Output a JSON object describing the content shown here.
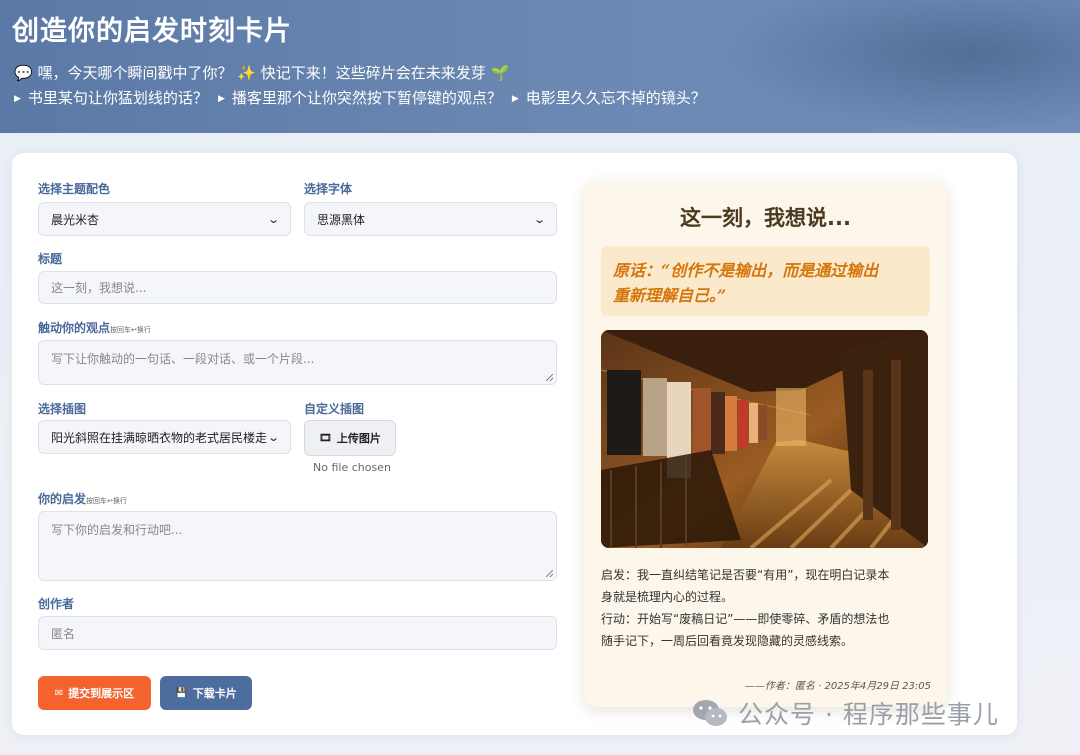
{
  "header": {
    "title": "创造你的启发时刻卡片",
    "line1": {
      "bubble_icon": "💬",
      "text_a": "嘿，今天哪个瞬间戳中了你？",
      "sparkle_icon": "✨",
      "text_b": "快记下来！这些碎片会在未来发芽",
      "sprout_icon": "🌱"
    },
    "prompts": [
      "书里某句让你猛划线的话？",
      "播客里那个让你突然按下暂停键的观点？",
      "电影里久久忘不掉的镜头？"
    ]
  },
  "form": {
    "theme": {
      "label": "选择主题配色",
      "value": "晨光米杏"
    },
    "font": {
      "label": "选择字体",
      "value": "思源黑体"
    },
    "title": {
      "label": "标题",
      "placeholder": "这一刻，我想说..."
    },
    "viewpoint": {
      "label": "触动你的观点",
      "hint": "按回车↩换行",
      "placeholder": "写下让你触动的一句话、一段对话、或一个片段..."
    },
    "illustration": {
      "label": "选择插图",
      "value": "阳光斜照在挂满晾晒衣物的老式居民楼走"
    },
    "custom_illustration": {
      "label": "自定义插图",
      "upload_label": "上传图片",
      "no_file": "No file chosen"
    },
    "insight": {
      "label": "你的启发",
      "hint": "按回车↩换行",
      "placeholder": "写下你的启发和行动吧..."
    },
    "author": {
      "label": "创作者",
      "placeholder": "匿名"
    },
    "submit_label": "提交到展示区",
    "download_label": "下载卡片"
  },
  "card": {
    "title": "这一刻，我想说...",
    "quote_line1": "原话：“创作不是输出，而是通过输出",
    "quote_line2": "重新理解自己。”",
    "insight_line1": "启发：我一直纠结笔记是否要“有用”，现在明白记录本",
    "insight_line2": "身就是梳理内心的过程。",
    "action_line1": "行动：开始写“废稿日记”——即使零碎、矛盾的想法也",
    "action_line2": "随手记下，一周后回看竟发现隐藏的灵感线索。",
    "signature": "——作者：匿名 · 2025年4月29日 23:05"
  },
  "watermark": {
    "text": "公众号 · 程序那些事儿"
  },
  "colors": {
    "header": "#5b79a6",
    "submit": "#f4622e",
    "download": "#4e6d9f",
    "card_bg": "#fdf6ea",
    "quote_text": "#d4760c",
    "label": "#4a6a9a"
  },
  "icons": {
    "upload": "film-icon",
    "submit": "envelope-icon",
    "download": "floppy-disk-icon",
    "watermark": "wechat-icon"
  }
}
